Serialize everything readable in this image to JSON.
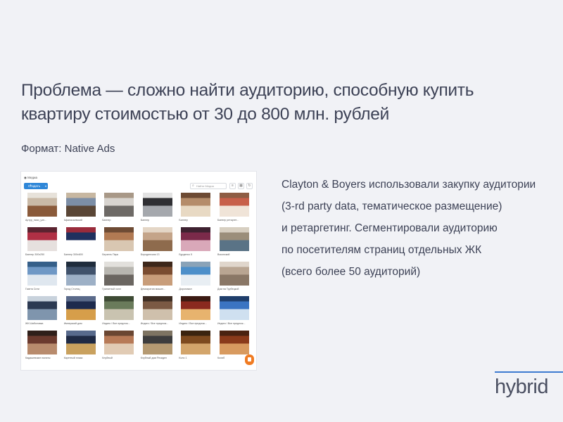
{
  "slide": {
    "title_line1": "Проблема — сложно найти аудиторию, способную купить",
    "title_line2": "квартиру стоимостью от 30 до 800 млн. рублей",
    "format": "Формат: Native Ads",
    "description": [
      "Clayton & Boyers использовали закупку аудитории",
      "(3-rd party data, тематическое размещение)",
      "и ретаргетинг. Сегментировали аудиторию",
      "по посетителям страниц отдельных ЖК",
      "(всего более 50 аудиторий)"
    ],
    "logo": "hybrid"
  },
  "screenshot": {
    "breadcrumb": "◉ Медиа",
    "create_button": "Создать",
    "search_placeholder": "Найти Медиа",
    "cards": [
      {
        "caption": "Артур_ниси_узн..."
      },
      {
        "caption": "Афанасьевский"
      },
      {
        "caption": "Баннер"
      },
      {
        "caption": "Баннер"
      },
      {
        "caption": "Баннер"
      },
      {
        "caption": "Баннер ретаргет..."
      },
      {
        "caption": "Баннер 300x250"
      },
      {
        "caption": "Баннер 300x600"
      },
      {
        "caption": "Берзель Парк"
      },
      {
        "caption": "Бородинская 13"
      },
      {
        "caption": "Бурденко 5"
      },
      {
        "caption": "Воконский"
      },
      {
        "caption": "Газета Сити"
      },
      {
        "caption": "Город Столиц"
      },
      {
        "caption": "Гранатный холл"
      },
      {
        "caption": "Демократия машин..."
      },
      {
        "caption": "Дорогомил"
      },
      {
        "caption": "Дом на Трубецкой"
      },
      {
        "caption": "ЖК Шаболовка"
      },
      {
        "caption": "Имперский дом"
      },
      {
        "caption": "Индиго / Все предлож..."
      },
      {
        "caption": "Индиго / Все предлож..."
      },
      {
        "caption": "Индиго / Все предлож..."
      },
      {
        "caption": "Индиго / Все предлож..."
      },
      {
        "caption": "Кадашевские палаты"
      },
      {
        "caption": "Каретный плаза"
      },
      {
        "caption": "Клубный"
      },
      {
        "caption": "Клубный дом Резиден"
      },
      {
        "caption": "Коло 1"
      },
      {
        "caption": "Колиб"
      }
    ],
    "colors": {
      "accent": "#2f87d8",
      "chat": "#f07b22",
      "logo_line": "#3e7bd0"
    }
  }
}
